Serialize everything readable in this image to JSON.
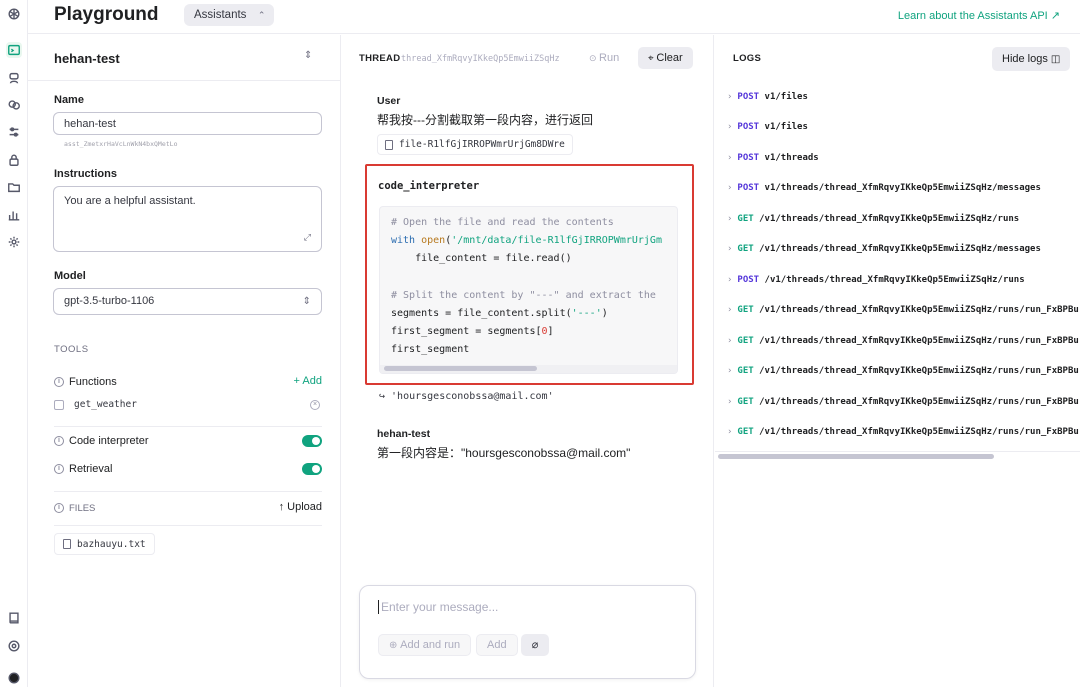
{
  "header": {
    "brand": "Playground",
    "mode": "Assistants",
    "learn_link": "Learn about the Assistants API ↗"
  },
  "assistant": {
    "name": "hehan-test",
    "name_label": "Name",
    "name_value": "hehan-test",
    "id": "asst_ZmetxrHaVcLnWkN4bxQMetLo",
    "instructions_label": "Instructions",
    "instructions_value": "You are a helpful assistant.",
    "model_label": "Model",
    "model_value": "gpt-3.5-turbo-1106",
    "tools_heading": "TOOLS",
    "functions_label": "Functions",
    "add_label": "+ Add",
    "function_name": "get_weather",
    "code_interpreter_label": "Code interpreter",
    "code_interpreter_enabled": true,
    "retrieval_label": "Retrieval",
    "retrieval_enabled": true,
    "files_heading": "FILES",
    "upload_label": "↑ Upload",
    "file_name": "bazhauyu.txt",
    "toggle_color": "#10a37f"
  },
  "thread": {
    "heading": "THREAD",
    "id": "thread_XfmRqvyIKkeQp5EmwiiZSqHz",
    "run_label": "Run",
    "clear_label": "Clear",
    "user_role": "User",
    "user_text": "帮我按---分割截取第一段内容，进行返回",
    "user_file": "file-R1lfGjIRROPWmrUrjGm8DWre",
    "tool_name": "code_interpreter",
    "code": {
      "l1": "# Open the file and read the contents",
      "l2_kw": "with",
      "l2_fn": "open",
      "l2_str": "'/mnt/data/file-R1lfGjIRROPWmrUrjGm",
      "l3": "    file_content = file.read()",
      "l5": "# Split the content by \"---\" and extract the",
      "l6_a": "segments = file_content.split(",
      "l6_str": "'---'",
      "l6_b": ")",
      "l7_a": "first_segment = segments[",
      "l7_num": "0",
      "l7_b": "]",
      "l8": "first_segment"
    },
    "tool_output": "↪ 'hoursgesconobssa@mail.com'",
    "assistant_role": "hehan-test",
    "assistant_text": "第一段内容是：\"hoursgesconobssa@mail.com\"",
    "composer_placeholder": "Enter your message...",
    "add_and_run_label": "Add and run",
    "add_button_label": "Add",
    "highlight_color": "#d93a32"
  },
  "logs": {
    "heading": "LOGS",
    "hide_label": "Hide logs",
    "entries": [
      {
        "method": "POST",
        "path": "v1/files"
      },
      {
        "method": "POST",
        "path": "v1/files"
      },
      {
        "method": "POST",
        "path": "v1/threads"
      },
      {
        "method": "POST",
        "path": "v1/threads/thread_XfmRqvyIKkeQp5EmwiiZSqHz/messages"
      },
      {
        "method": "GET",
        "path": "/v1/threads/thread_XfmRqvyIKkeQp5EmwiiZSqHz/runs"
      },
      {
        "method": "GET",
        "path": "/v1/threads/thread_XfmRqvyIKkeQp5EmwiiZSqHz/messages"
      },
      {
        "method": "POST",
        "path": "/v1/threads/thread_XfmRqvyIKkeQp5EmwiiZSqHz/runs"
      },
      {
        "method": "GET",
        "path": "/v1/threads/thread_XfmRqvyIKkeQp5EmwiiZSqHz/runs/run_FxBPBu"
      },
      {
        "method": "GET",
        "path": "/v1/threads/thread_XfmRqvyIKkeQp5EmwiiZSqHz/runs/run_FxBPBu"
      },
      {
        "method": "GET",
        "path": "/v1/threads/thread_XfmRqvyIKkeQp5EmwiiZSqHz/runs/run_FxBPBu"
      },
      {
        "method": "GET",
        "path": "/v1/threads/thread_XfmRqvyIKkeQp5EmwiiZSqHz/runs/run_FxBPBu"
      },
      {
        "method": "GET",
        "path": "/v1/threads/thread_XfmRqvyIKkeQp5EmwiiZSqHz/runs/run_FxBPBu"
      }
    ]
  },
  "icons": {
    "rail": [
      "openai-logo-icon",
      "terminal-icon",
      "chat-icon",
      "assistant-icon",
      "sliders-icon",
      "lock-icon",
      "folder-icon",
      "bar-chart-icon",
      "gear-icon",
      "book-icon",
      "help-icon",
      "avatar"
    ]
  }
}
